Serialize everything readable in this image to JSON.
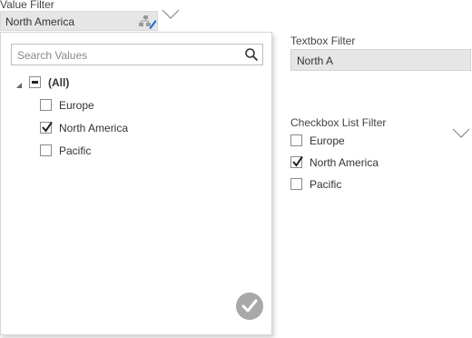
{
  "value_filter": {
    "label": "Value Filter",
    "selected_value": "North America",
    "search": {
      "placeholder": "Search Values"
    },
    "tree": {
      "all_label": "(All)",
      "items": [
        {
          "label": "Europe",
          "checked": false
        },
        {
          "label": "North America",
          "checked": true
        },
        {
          "label": "Pacific",
          "checked": false
        }
      ]
    }
  },
  "textbox_filter": {
    "label": "Textbox Filter",
    "value": "North A"
  },
  "checkbox_list_filter": {
    "label": "Checkbox List Filter",
    "items": [
      {
        "label": "Europe",
        "checked": false
      },
      {
        "label": "North America",
        "checked": true
      },
      {
        "label": "Pacific",
        "checked": false
      }
    ]
  },
  "colors": {
    "accent_blue": "#1f6fd6",
    "field_bg": "#e6e6e6",
    "ok_button": "#a8a8a8"
  }
}
